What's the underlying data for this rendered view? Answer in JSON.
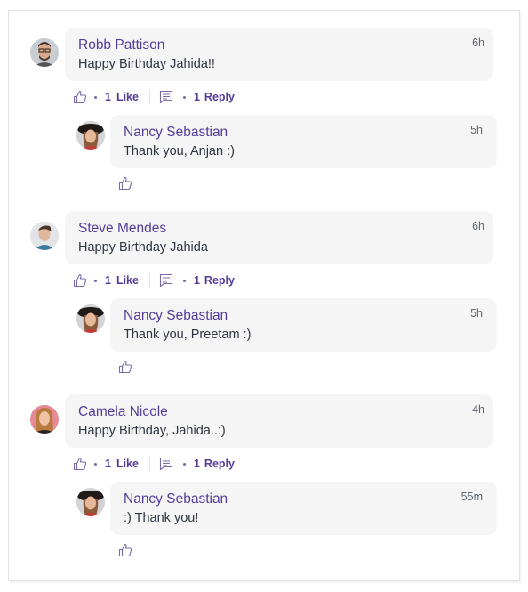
{
  "colors": {
    "accent": "#553c9a",
    "bubble": "#f5f5f5",
    "text": "#2e3440",
    "muted": "#5f6673"
  },
  "comments": [
    {
      "author": "Robb Pattison",
      "text": "Happy Birthday Jahida!!",
      "time": "6h",
      "like_count": "1",
      "like_label": "Like",
      "reply_count": "1",
      "reply_label": "Reply",
      "avatar_icon": "user-avatar-man-glasses",
      "reply": {
        "author": "Nancy Sebastian",
        "text": "Thank you, Anjan :)",
        "time": "5h",
        "avatar_icon": "user-avatar-woman-hat"
      }
    },
    {
      "author": "Steve Mendes",
      "text": "Happy Birthday Jahida",
      "time": "6h",
      "like_count": "1",
      "like_label": "Like",
      "reply_count": "1",
      "reply_label": "Reply",
      "avatar_icon": "user-avatar-man",
      "reply": {
        "author": "Nancy Sebastian",
        "text": "Thank you, Preetam :)",
        "time": "5h",
        "avatar_icon": "user-avatar-woman-hat"
      }
    },
    {
      "author": "Camela Nicole",
      "text": "Happy Birthday, Jahida..:)",
      "time": "4h",
      "like_count": "1",
      "like_label": "Like",
      "reply_count": "1",
      "reply_label": "Reply",
      "avatar_icon": "user-avatar-woman",
      "reply": {
        "author": "Nancy Sebastian",
        "text": ":) Thank you!",
        "time": "55m",
        "avatar_icon": "user-avatar-woman-hat"
      }
    }
  ]
}
